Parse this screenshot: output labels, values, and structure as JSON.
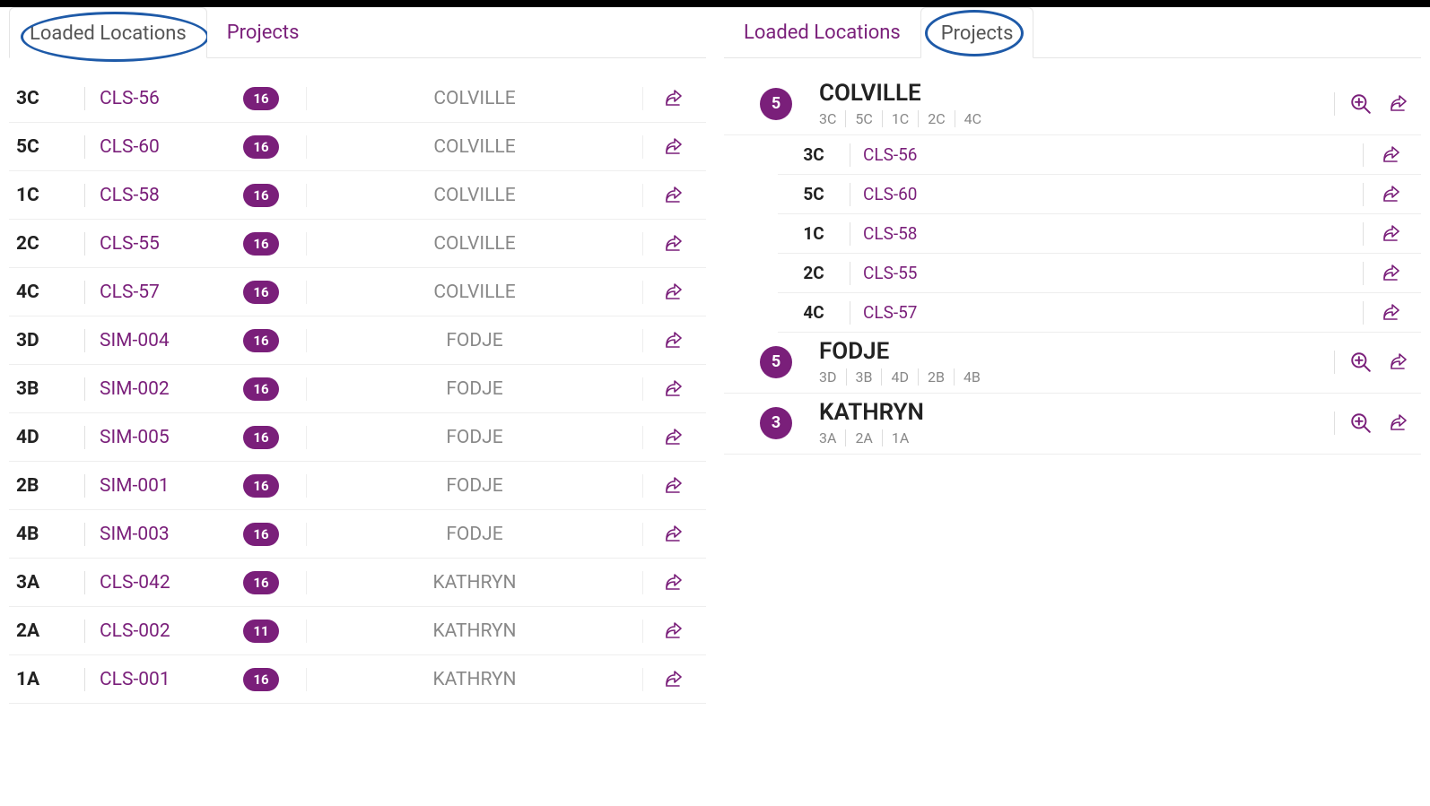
{
  "left": {
    "tabs": {
      "loaded": "Loaded Locations",
      "projects": "Projects",
      "active": "loaded"
    },
    "rows": [
      {
        "pos": "3C",
        "code": "CLS-56",
        "count": "16",
        "project": "COLVILLE"
      },
      {
        "pos": "5C",
        "code": "CLS-60",
        "count": "16",
        "project": "COLVILLE"
      },
      {
        "pos": "1C",
        "code": "CLS-58",
        "count": "16",
        "project": "COLVILLE"
      },
      {
        "pos": "2C",
        "code": "CLS-55",
        "count": "16",
        "project": "COLVILLE"
      },
      {
        "pos": "4C",
        "code": "CLS-57",
        "count": "16",
        "project": "COLVILLE"
      },
      {
        "pos": "3D",
        "code": "SIM-004",
        "count": "16",
        "project": "FODJE"
      },
      {
        "pos": "3B",
        "code": "SIM-002",
        "count": "16",
        "project": "FODJE"
      },
      {
        "pos": "4D",
        "code": "SIM-005",
        "count": "16",
        "project": "FODJE"
      },
      {
        "pos": "2B",
        "code": "SIM-001",
        "count": "16",
        "project": "FODJE"
      },
      {
        "pos": "4B",
        "code": "SIM-003",
        "count": "16",
        "project": "FODJE"
      },
      {
        "pos": "3A",
        "code": "CLS-042",
        "count": "16",
        "project": "KATHRYN"
      },
      {
        "pos": "2A",
        "code": "CLS-002",
        "count": "11",
        "project": "KATHRYN"
      },
      {
        "pos": "1A",
        "code": "CLS-001",
        "count": "16",
        "project": "KATHRYN"
      }
    ]
  },
  "right": {
    "tabs": {
      "loaded": "Loaded Locations",
      "projects": "Projects",
      "active": "projects"
    },
    "groups": [
      {
        "count": "5",
        "name": "COLVILLE",
        "tags": [
          "3C",
          "5C",
          "1C",
          "2C",
          "4C"
        ],
        "expanded": true,
        "items": [
          {
            "pos": "3C",
            "code": "CLS-56"
          },
          {
            "pos": "5C",
            "code": "CLS-60"
          },
          {
            "pos": "1C",
            "code": "CLS-58"
          },
          {
            "pos": "2C",
            "code": "CLS-55"
          },
          {
            "pos": "4C",
            "code": "CLS-57"
          }
        ]
      },
      {
        "count": "5",
        "name": "FODJE",
        "tags": [
          "3D",
          "3B",
          "4D",
          "2B",
          "4B"
        ],
        "expanded": false,
        "items": []
      },
      {
        "count": "3",
        "name": "KATHRYN",
        "tags": [
          "3A",
          "2A",
          "1A"
        ],
        "expanded": false,
        "items": []
      }
    ]
  }
}
